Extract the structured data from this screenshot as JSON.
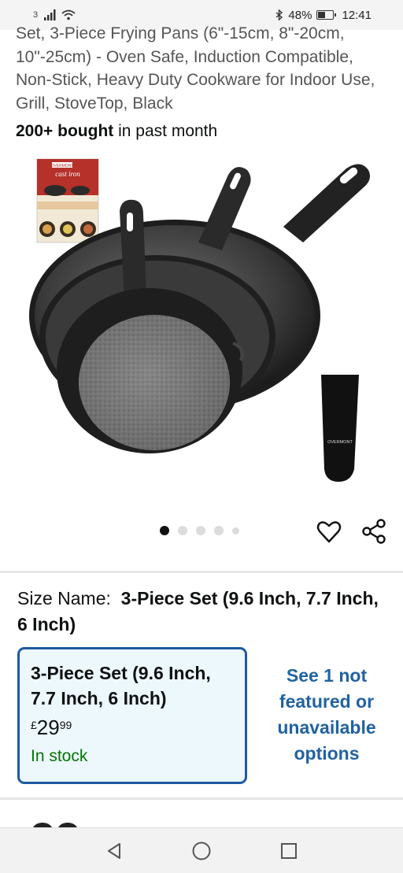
{
  "status_bar": {
    "sim": "3",
    "battery": "48%",
    "time": "12:41"
  },
  "product": {
    "title": "Set, 3-Piece Frying Pans (6\"-15cm, 8\"-20cm, 10\"-25cm) - Oven Safe, Induction Compatible, Non-Stick, Heavy Duty Cookware for Indoor Use, Grill, StoveTop, Black",
    "bought_bold": "200+ bought",
    "bought_rest": " in past month",
    "image_alt": "Cast iron frying pan set",
    "booklet_brand": "OVERMONT",
    "booklet_title": "cast iron",
    "handle_brand": "OVERMONT"
  },
  "carousel": {
    "pages": 5,
    "active": 0
  },
  "size": {
    "label": "Size Name:",
    "value": "3-Piece Set (9.6 Inch, 7.7 Inch, 6 Inch)"
  },
  "variant": {
    "name": "3-Piece Set (9.6 Inch, 7.7 Inch, 6 Inch)",
    "currency": "£",
    "price_whole": "29",
    "price_fraction": "99",
    "stock": "In stock"
  },
  "see_more": "See 1 not featured or unavailable options",
  "icons": {
    "wishlist": "heart-icon",
    "share": "share-icon",
    "back": "back-triangle-icon",
    "home": "home-circle-icon",
    "recents": "recents-square-icon"
  },
  "colors": {
    "link": "#2162a1",
    "selected_border": "#1e5aa0",
    "selected_bg": "#edf8fd",
    "in_stock": "#007600"
  }
}
